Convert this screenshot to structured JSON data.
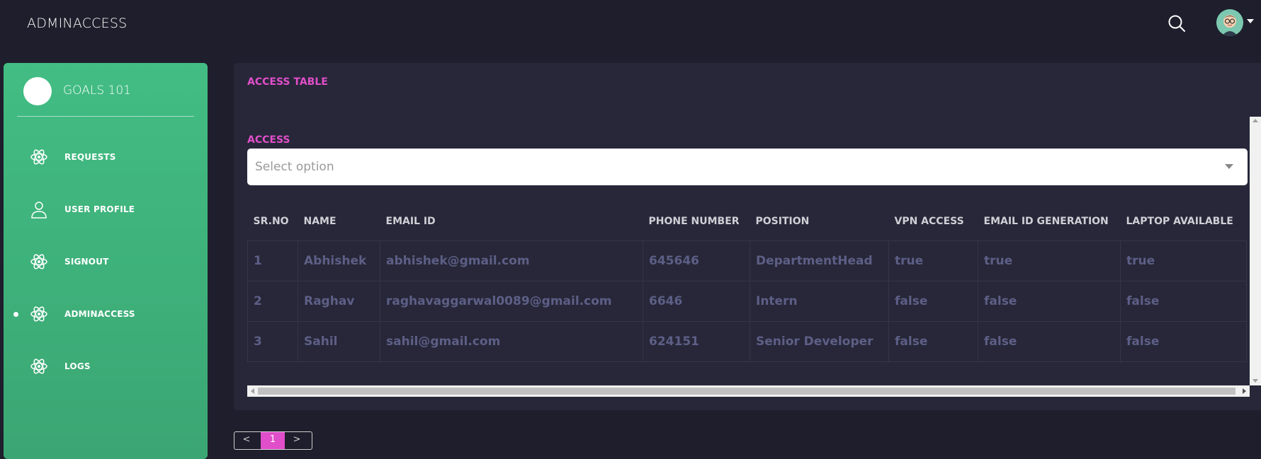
{
  "topbar": {
    "brand": "ADMINACCESS",
    "search_icon": "search-icon",
    "avatar_icon": "user-avatar"
  },
  "sidebar": {
    "name": "GOALS 101",
    "items": [
      {
        "label": "REQUESTS",
        "icon": "atom-icon",
        "active": false
      },
      {
        "label": "USER PROFILE",
        "icon": "user-icon",
        "active": false
      },
      {
        "label": "SIGNOUT",
        "icon": "atom-icon",
        "active": false
      },
      {
        "label": "ADMINACCESS",
        "icon": "atom-icon",
        "active": true
      },
      {
        "label": "LOGS",
        "icon": "atom-icon",
        "active": false
      }
    ]
  },
  "main": {
    "title": "ACCESS TABLE",
    "access_label": "ACCESS",
    "select_placeholder": "Select option",
    "table": {
      "headers": [
        "SR.NO",
        "NAME",
        "EMAIL ID",
        "PHONE NUMBER",
        "POSITION",
        "VPN ACCESS",
        "EMAIL ID GENERATION",
        "LAPTOP AVAILABLE"
      ],
      "rows": [
        [
          "1",
          "Abhishek",
          "abhishek@gmail.com",
          "645646",
          "DepartmentHead",
          "true",
          "true",
          "true"
        ],
        [
          "2",
          "Raghav",
          "raghavaggarwal0089@gmail.com",
          "6646",
          "Intern",
          "false",
          "false",
          "false"
        ],
        [
          "3",
          "Sahil",
          "sahil@gmail.com",
          "624151",
          "Senior Developer",
          "false",
          "false",
          "false"
        ]
      ]
    }
  },
  "pagination": {
    "prev": "<",
    "current": "1",
    "next": ">"
  },
  "colors": {
    "background": "#1e1e2c",
    "panel": "#272739",
    "sidebar": "#42bd83",
    "accent": "#e14eca",
    "cell_text": "#5d5f86"
  }
}
